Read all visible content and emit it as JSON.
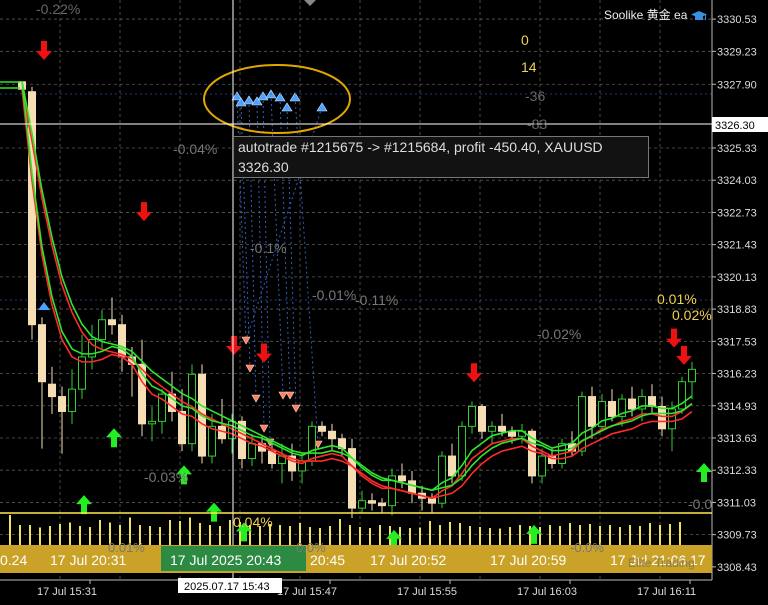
{
  "colors": {
    "background": "#000000",
    "grid": "#5a5a5a",
    "bull": "#33cc33",
    "bear": "#f5deb3",
    "ma_fast": "#ff2a2a",
    "ma_slow": "#2ee62e",
    "arrow_up": "#22ee22",
    "arrow_down": "#ee1111",
    "ellipse": "#e0a800"
  },
  "expert": {
    "name": "Soolike 黄金 ea",
    "icon": "graduation-cap-icon"
  },
  "price_axis": {
    "labels": [
      "3330.53",
      "3329.23",
      "3327.90",
      "3326.30",
      "3325.33",
      "3324.03",
      "3322.73",
      "3321.43",
      "3320.13",
      "3318.83",
      "3317.53",
      "3316.23",
      "3314.93",
      "3313.63",
      "3312.33",
      "3311.03",
      "3309.73",
      "3308.43"
    ],
    "current_price": "3326.30"
  },
  "time_axis": {
    "labels": [
      "17 Jul 15:31",
      "2025.07.17 15:43",
      "17 Jul 15:47",
      "17 Jul 15:55",
      "17 Jul 16:03",
      "17 Jul 16:11"
    ]
  },
  "tooltip": {
    "line1": "autotrade #1215675 -> #1215684, profit -450.40, XAUUSD",
    "line2": "3326.30"
  },
  "stats": {
    "top_left": "-0.22%",
    "values": [
      "0",
      "14",
      "-36",
      "-83"
    ]
  },
  "percent_labels": [
    "-0.04%",
    "-0.1%",
    "-0.01%",
    "-0.11%",
    "-0.02%",
    "0.01%",
    "0.02%",
    "-0.03%",
    "0.04%",
    "-0.0"
  ],
  "bottom_strip": {
    "labels": [
      "0.24",
      "17 Jul 20:31",
      "17 Jul 2025 20:43",
      "20:45",
      "17 Jul 20:52",
      "17 Jul 20:59",
      "17 Jul 21:06",
      "17"
    ],
    "highlight": "17 Jul 2025 20:43",
    "faint": [
      "0.01%",
      "0.0%",
      "-0.0%",
      "Elite Trading"
    ]
  },
  "chart_data": {
    "type": "candlestick",
    "symbol": "XAUUSD",
    "timeframe": "M1",
    "ylim": [
      3307.9,
      3331.3
    ],
    "candles": [
      [
        3328.0,
        3328.0,
        3327.6,
        3327.7
      ],
      [
        3327.6,
        3327.8,
        3317.6,
        3318.2
      ],
      [
        3318.2,
        3318.5,
        3313.2,
        3315.9
      ],
      [
        3315.8,
        3316.5,
        3314.6,
        3315.3
      ],
      [
        3315.3,
        3315.7,
        3313.0,
        3314.7
      ],
      [
        3314.7,
        3316.4,
        3314.2,
        3315.6
      ],
      [
        3315.6,
        3317.8,
        3315.2,
        3316.9
      ],
      [
        3316.9,
        3318.2,
        3316.4,
        3317.6
      ],
      [
        3317.6,
        3318.8,
        3317.2,
        3318.4
      ],
      [
        3318.4,
        3319.3,
        3317.8,
        3318.2
      ],
      [
        3318.2,
        3318.6,
        3316.3,
        3316.9
      ],
      [
        3316.9,
        3317.3,
        3315.3,
        3316.6
      ],
      [
        3316.6,
        3317.6,
        3313.7,
        3314.2
      ],
      [
        3314.2,
        3314.9,
        3313.5,
        3314.3
      ],
      [
        3314.3,
        3315.6,
        3313.8,
        3315.4
      ],
      [
        3315.4,
        3316.3,
        3314.3,
        3314.7
      ],
      [
        3314.7,
        3315.6,
        3313.1,
        3313.4
      ],
      [
        3313.4,
        3316.6,
        3313.1,
        3316.2
      ],
      [
        3316.2,
        3316.6,
        3312.6,
        3312.9
      ],
      [
        3312.9,
        3314.6,
        3312.6,
        3314.1
      ],
      [
        3314.1,
        3315.2,
        3313.4,
        3313.6
      ],
      [
        3313.6,
        3314.6,
        3313.0,
        3314.3
      ],
      [
        3314.3,
        3314.5,
        3312.4,
        3312.8
      ],
      [
        3312.8,
        3313.8,
        3312.5,
        3313.4
      ],
      [
        3313.4,
        3313.7,
        3312.6,
        3313.1
      ],
      [
        3313.1,
        3313.4,
        3312.4,
        3312.6
      ],
      [
        3312.6,
        3313.4,
        3311.8,
        3312.9
      ],
      [
        3312.9,
        3313.4,
        3311.9,
        3312.3
      ],
      [
        3312.3,
        3313.0,
        3311.8,
        3312.7
      ],
      [
        3312.7,
        3314.3,
        3312.5,
        3314.1
      ],
      [
        3314.1,
        3314.3,
        3313.7,
        3313.9
      ],
      [
        3313.9,
        3314.2,
        3313.1,
        3313.6
      ],
      [
        3313.6,
        3313.8,
        3312.9,
        3313.2
      ],
      [
        3313.2,
        3313.6,
        3310.4,
        3310.8
      ],
      [
        3310.8,
        3311.5,
        3310.6,
        3311.1
      ],
      [
        3311.1,
        3311.4,
        3310.7,
        3311.0
      ],
      [
        3311.0,
        3311.2,
        3310.6,
        3310.9
      ],
      [
        3310.9,
        3312.4,
        3310.5,
        3312.1
      ],
      [
        3312.1,
        3312.6,
        3311.6,
        3311.9
      ],
      [
        3311.9,
        3312.3,
        3311.0,
        3311.4
      ],
      [
        3311.4,
        3311.7,
        3310.7,
        3311.2
      ],
      [
        3311.2,
        3311.4,
        3310.6,
        3311.0
      ],
      [
        3311.0,
        3313.1,
        3310.8,
        3312.9
      ],
      [
        3312.9,
        3313.4,
        3311.8,
        3312.1
      ],
      [
        3312.1,
        3314.3,
        3311.9,
        3314.1
      ],
      [
        3314.1,
        3315.1,
        3313.8,
        3314.9
      ],
      [
        3314.9,
        3315.0,
        3313.6,
        3313.9
      ],
      [
        3313.9,
        3314.3,
        3313.4,
        3314.1
      ],
      [
        3314.1,
        3314.6,
        3313.7,
        3313.9
      ],
      [
        3313.9,
        3314.1,
        3313.4,
        3313.7
      ],
      [
        3313.7,
        3314.2,
        3313.4,
        3313.9
      ],
      [
        3313.9,
        3314.0,
        3311.8,
        3312.1
      ],
      [
        3312.1,
        3313.2,
        3311.8,
        3312.9
      ],
      [
        3312.9,
        3313.2,
        3312.4,
        3312.6
      ],
      [
        3312.6,
        3313.6,
        3312.4,
        3313.4
      ],
      [
        3313.4,
        3313.9,
        3312.9,
        3313.1
      ],
      [
        3313.1,
        3315.5,
        3312.9,
        3315.3
      ],
      [
        3315.3,
        3315.7,
        3313.6,
        3314.1
      ],
      [
        3314.1,
        3315.4,
        3313.9,
        3315.1
      ],
      [
        3315.1,
        3315.6,
        3314.3,
        3314.5
      ],
      [
        3314.5,
        3315.4,
        3314.1,
        3315.2
      ],
      [
        3315.2,
        3315.7,
        3314.5,
        3314.8
      ],
      [
        3314.8,
        3315.6,
        3314.3,
        3315.3
      ],
      [
        3315.3,
        3315.8,
        3314.6,
        3314.9
      ],
      [
        3314.9,
        3315.3,
        3313.7,
        3314.0
      ],
      [
        3314.0,
        3315.1,
        3313.1,
        3314.8
      ],
      [
        3314.8,
        3316.1,
        3314.6,
        3315.9
      ],
      [
        3315.9,
        3316.7,
        3315.2,
        3316.4
      ]
    ],
    "ma_fast": [
      3327.7,
      3324.0,
      3321.0,
      3319.0,
      3317.6,
      3316.9,
      3316.7,
      3316.7,
      3316.8,
      3317.0,
      3316.9,
      3316.6,
      3315.9,
      3315.4,
      3315.2,
      3314.9,
      3314.6,
      3314.5,
      3314.2,
      3314.0,
      3313.9,
      3313.8,
      3313.6,
      3313.4,
      3313.3,
      3313.1,
      3312.9,
      3312.7,
      3312.6,
      3312.8,
      3312.9,
      3313.0,
      3312.9,
      3312.5,
      3312.1,
      3311.8,
      3311.6,
      3311.6,
      3311.5,
      3311.4,
      3311.3,
      3311.2,
      3311.5,
      3311.7,
      3312.2,
      3312.8,
      3313.1,
      3313.4,
      3313.5,
      3313.6,
      3313.6,
      3313.3,
      3313.1,
      3312.9,
      3313.0,
      3313.1,
      3313.5,
      3313.7,
      3314.0,
      3314.1,
      3314.3,
      3314.4,
      3314.6,
      3314.6,
      3314.5,
      3314.5,
      3314.7,
      3315.0
    ],
    "ma_slow": [
      3327.9,
      3325.8,
      3323.5,
      3321.6,
      3320.0,
      3318.9,
      3318.1,
      3317.6,
      3317.4,
      3317.3,
      3317.2,
      3317.0,
      3316.6,
      3316.2,
      3315.9,
      3315.6,
      3315.3,
      3315.1,
      3314.8,
      3314.6,
      3314.4,
      3314.2,
      3314.0,
      3313.8,
      3313.6,
      3313.4,
      3313.2,
      3313.0,
      3312.9,
      3312.9,
      3312.9,
      3313.0,
      3312.9,
      3312.7,
      3312.4,
      3312.1,
      3311.9,
      3311.8,
      3311.7,
      3311.6,
      3311.5,
      3311.4,
      3311.5,
      3311.6,
      3311.9,
      3312.4,
      3312.8,
      3313.1,
      3313.3,
      3313.4,
      3313.5,
      3313.3,
      3313.2,
      3313.0,
      3313.0,
      3313.1,
      3313.4,
      3313.6,
      3313.8,
      3314.0,
      3314.1,
      3314.2,
      3314.4,
      3314.5,
      3314.5,
      3314.5,
      3314.6,
      3314.9
    ],
    "signals": [
      {
        "dir": "down",
        "i": 1,
        "price": 3329.2
      },
      {
        "dir": "down",
        "i": 11,
        "price": 3322.7
      },
      {
        "dir": "down",
        "i": 20,
        "price": 3317.3
      },
      {
        "dir": "down",
        "i": 23,
        "price": 3317.0
      },
      {
        "dir": "down",
        "i": 44,
        "price": 3316.2
      },
      {
        "dir": "down",
        "i": 64,
        "price": 3317.6
      },
      {
        "dir": "down",
        "i": 65,
        "price": 3316.9
      },
      {
        "dir": "up",
        "i": 8,
        "price": 3313.7
      },
      {
        "dir": "up",
        "i": 5,
        "price": 3311.0
      },
      {
        "dir": "up",
        "i": 15,
        "price": 3312.2
      },
      {
        "dir": "up",
        "i": 18,
        "price": 3310.7
      },
      {
        "dir": "up",
        "i": 21,
        "price": 3309.9
      },
      {
        "dir": "up",
        "i": 36,
        "price": 3309.6
      },
      {
        "dir": "up",
        "i": 50,
        "price": 3309.8
      },
      {
        "dir": "up",
        "i": 67,
        "price": 3312.3
      }
    ],
    "volume": [
      60,
      40,
      40,
      35,
      38,
      42,
      45,
      38,
      36,
      50,
      45,
      40,
      55,
      40,
      38,
      36,
      50,
      48,
      55,
      44,
      40,
      38,
      50,
      46,
      40,
      38,
      42,
      40,
      38,
      44,
      36,
      34,
      38,
      52,
      40,
      36,
      34,
      40,
      38,
      36,
      34,
      35,
      48,
      40,
      46,
      44,
      38,
      36,
      34,
      33,
      36,
      40,
      38,
      36,
      40,
      38,
      44,
      40,
      42,
      38,
      40,
      36,
      40,
      38,
      44,
      40,
      42,
      46
    ],
    "volume_range": [
      0,
      60
    ]
  }
}
